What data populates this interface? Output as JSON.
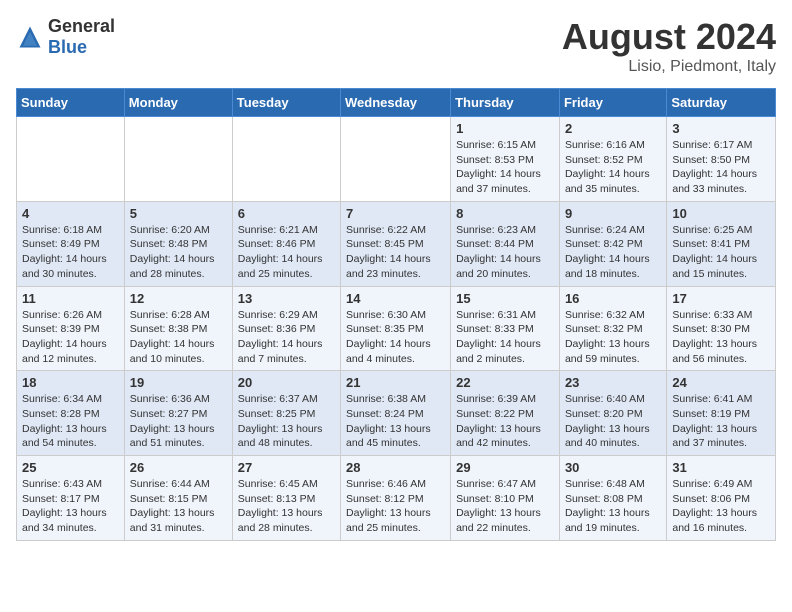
{
  "header": {
    "logo_general": "General",
    "logo_blue": "Blue",
    "month_year": "August 2024",
    "location": "Lisio, Piedmont, Italy"
  },
  "days_of_week": [
    "Sunday",
    "Monday",
    "Tuesday",
    "Wednesday",
    "Thursday",
    "Friday",
    "Saturday"
  ],
  "weeks": [
    [
      {
        "day": "",
        "info": ""
      },
      {
        "day": "",
        "info": ""
      },
      {
        "day": "",
        "info": ""
      },
      {
        "day": "",
        "info": ""
      },
      {
        "day": "1",
        "info": "Sunrise: 6:15 AM\nSunset: 8:53 PM\nDaylight: 14 hours and 37 minutes."
      },
      {
        "day": "2",
        "info": "Sunrise: 6:16 AM\nSunset: 8:52 PM\nDaylight: 14 hours and 35 minutes."
      },
      {
        "day": "3",
        "info": "Sunrise: 6:17 AM\nSunset: 8:50 PM\nDaylight: 14 hours and 33 minutes."
      }
    ],
    [
      {
        "day": "4",
        "info": "Sunrise: 6:18 AM\nSunset: 8:49 PM\nDaylight: 14 hours and 30 minutes."
      },
      {
        "day": "5",
        "info": "Sunrise: 6:20 AM\nSunset: 8:48 PM\nDaylight: 14 hours and 28 minutes."
      },
      {
        "day": "6",
        "info": "Sunrise: 6:21 AM\nSunset: 8:46 PM\nDaylight: 14 hours and 25 minutes."
      },
      {
        "day": "7",
        "info": "Sunrise: 6:22 AM\nSunset: 8:45 PM\nDaylight: 14 hours and 23 minutes."
      },
      {
        "day": "8",
        "info": "Sunrise: 6:23 AM\nSunset: 8:44 PM\nDaylight: 14 hours and 20 minutes."
      },
      {
        "day": "9",
        "info": "Sunrise: 6:24 AM\nSunset: 8:42 PM\nDaylight: 14 hours and 18 minutes."
      },
      {
        "day": "10",
        "info": "Sunrise: 6:25 AM\nSunset: 8:41 PM\nDaylight: 14 hours and 15 minutes."
      }
    ],
    [
      {
        "day": "11",
        "info": "Sunrise: 6:26 AM\nSunset: 8:39 PM\nDaylight: 14 hours and 12 minutes."
      },
      {
        "day": "12",
        "info": "Sunrise: 6:28 AM\nSunset: 8:38 PM\nDaylight: 14 hours and 10 minutes."
      },
      {
        "day": "13",
        "info": "Sunrise: 6:29 AM\nSunset: 8:36 PM\nDaylight: 14 hours and 7 minutes."
      },
      {
        "day": "14",
        "info": "Sunrise: 6:30 AM\nSunset: 8:35 PM\nDaylight: 14 hours and 4 minutes."
      },
      {
        "day": "15",
        "info": "Sunrise: 6:31 AM\nSunset: 8:33 PM\nDaylight: 14 hours and 2 minutes."
      },
      {
        "day": "16",
        "info": "Sunrise: 6:32 AM\nSunset: 8:32 PM\nDaylight: 13 hours and 59 minutes."
      },
      {
        "day": "17",
        "info": "Sunrise: 6:33 AM\nSunset: 8:30 PM\nDaylight: 13 hours and 56 minutes."
      }
    ],
    [
      {
        "day": "18",
        "info": "Sunrise: 6:34 AM\nSunset: 8:28 PM\nDaylight: 13 hours and 54 minutes."
      },
      {
        "day": "19",
        "info": "Sunrise: 6:36 AM\nSunset: 8:27 PM\nDaylight: 13 hours and 51 minutes."
      },
      {
        "day": "20",
        "info": "Sunrise: 6:37 AM\nSunset: 8:25 PM\nDaylight: 13 hours and 48 minutes."
      },
      {
        "day": "21",
        "info": "Sunrise: 6:38 AM\nSunset: 8:24 PM\nDaylight: 13 hours and 45 minutes."
      },
      {
        "day": "22",
        "info": "Sunrise: 6:39 AM\nSunset: 8:22 PM\nDaylight: 13 hours and 42 minutes."
      },
      {
        "day": "23",
        "info": "Sunrise: 6:40 AM\nSunset: 8:20 PM\nDaylight: 13 hours and 40 minutes."
      },
      {
        "day": "24",
        "info": "Sunrise: 6:41 AM\nSunset: 8:19 PM\nDaylight: 13 hours and 37 minutes."
      }
    ],
    [
      {
        "day": "25",
        "info": "Sunrise: 6:43 AM\nSunset: 8:17 PM\nDaylight: 13 hours and 34 minutes."
      },
      {
        "day": "26",
        "info": "Sunrise: 6:44 AM\nSunset: 8:15 PM\nDaylight: 13 hours and 31 minutes."
      },
      {
        "day": "27",
        "info": "Sunrise: 6:45 AM\nSunset: 8:13 PM\nDaylight: 13 hours and 28 minutes."
      },
      {
        "day": "28",
        "info": "Sunrise: 6:46 AM\nSunset: 8:12 PM\nDaylight: 13 hours and 25 minutes."
      },
      {
        "day": "29",
        "info": "Sunrise: 6:47 AM\nSunset: 8:10 PM\nDaylight: 13 hours and 22 minutes."
      },
      {
        "day": "30",
        "info": "Sunrise: 6:48 AM\nSunset: 8:08 PM\nDaylight: 13 hours and 19 minutes."
      },
      {
        "day": "31",
        "info": "Sunrise: 6:49 AM\nSunset: 8:06 PM\nDaylight: 13 hours and 16 minutes."
      }
    ]
  ]
}
